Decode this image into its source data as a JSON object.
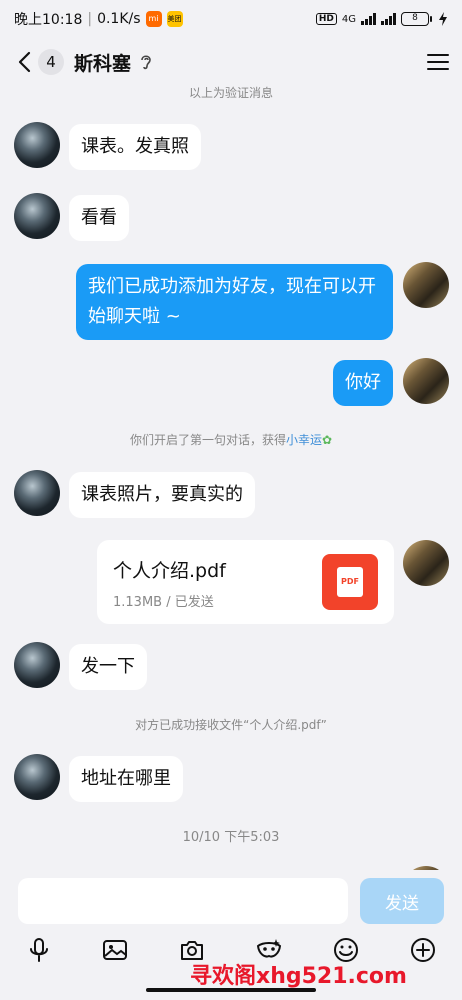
{
  "status_bar": {
    "time": "晚上10:18",
    "speed": "0.1K/s",
    "app_icon_1": "mi",
    "app_icon_2": "美团",
    "hd": "HD",
    "network": "4G",
    "battery": "8"
  },
  "header": {
    "unread_count": "4",
    "title": "斯科塞"
  },
  "system_top": "以上为验证消息",
  "messages": [
    {
      "text": "课表。发真照"
    },
    {
      "text": "看看"
    },
    {
      "text": "我们已成功添加为好友，现在可以开始聊天啦 ~"
    },
    {
      "text": "你好"
    },
    {
      "text": "课表照片，要真实的"
    },
    {
      "text": "发一下"
    },
    {
      "text": "地址在哪里"
    }
  ],
  "system_first": {
    "prefix": "你们开启了第一句对话，获得",
    "link": "小幸运"
  },
  "file": {
    "name": "个人介绍.pdf",
    "meta": "1.13MB / 已发送",
    "icon_label": "PDF"
  },
  "system_received": "对方已成功接收文件“个人介绍.pdf”",
  "timestamp": "10/10 下午5:03",
  "input": {
    "placeholder": "",
    "send_label": "发送"
  },
  "watermark": "寻欢阁xhg521.com",
  "colors": {
    "outgoing_bubble": "#1a9bf6",
    "send_button": "#a9d6f7",
    "link": "#3f8fd8"
  }
}
